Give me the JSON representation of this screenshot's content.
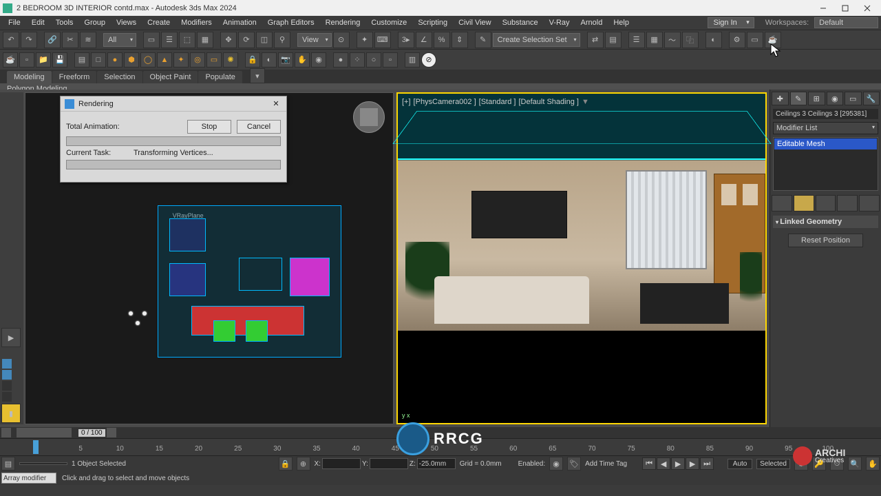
{
  "titlebar": {
    "text": "2 BEDROOM 3D  INTERIOR contd.max - Autodesk 3ds Max 2024"
  },
  "menubar": {
    "items": [
      "File",
      "Edit",
      "Tools",
      "Group",
      "Views",
      "Create",
      "Modifiers",
      "Animation",
      "Graph Editors",
      "Rendering",
      "Customize",
      "Scripting",
      "Civil View",
      "Substance",
      "V-Ray",
      "Arnold",
      "Help"
    ],
    "signin": "Sign In",
    "ws_label": "Workspaces:",
    "ws_value": "Default"
  },
  "toolbar": {
    "filter_all": "All",
    "view": "View",
    "selection_set": "Create Selection Set"
  },
  "ribbon": {
    "tabs": [
      "Modeling",
      "Freeform",
      "Selection",
      "Object Paint",
      "Populate"
    ],
    "sub": "Polygon Modeling"
  },
  "dialog": {
    "title": "Rendering",
    "total": "Total Animation:",
    "task_label": "Current Task:",
    "task_value": "Transforming Vertices...",
    "stop": "Stop",
    "cancel": "Cancel"
  },
  "viewport": {
    "right_labels": [
      "[+]",
      "[PhysCamera002 ]",
      "[Standard ]",
      "[Default Shading ]"
    ],
    "vrayplane": "VRayPlane",
    "axis": "y\n     x"
  },
  "cmdpanel": {
    "obj": "Ceilings 3 Ceilings 3 [295381]",
    "modlist": "Modifier List",
    "stack_item": "Editable Mesh",
    "rollout_hdr": "Linked Geometry",
    "reset": "Reset Position"
  },
  "track": {
    "pos": "0 / 100"
  },
  "timeline": {
    "ticks": [
      "5",
      "10",
      "15",
      "20",
      "25",
      "30",
      "35",
      "40",
      "45",
      "50",
      "55",
      "60",
      "65",
      "70",
      "75",
      "80",
      "85",
      "90",
      "95",
      "100"
    ]
  },
  "status": {
    "selected": "1 Object Selected",
    "x": "",
    "y": "",
    "z": "-25.0mm",
    "grid": "Grid = 0.0mm",
    "enabled": "Enabled:",
    "addtag": "Add Time Tag",
    "auto": "Auto",
    "sel": "Selected",
    "prompt_input": "Array modifier",
    "prompt": "Click and drag to select and move objects"
  },
  "brand": {
    "big": "RRCG",
    "right1": "ARCHI",
    "right2": "Creatives"
  }
}
